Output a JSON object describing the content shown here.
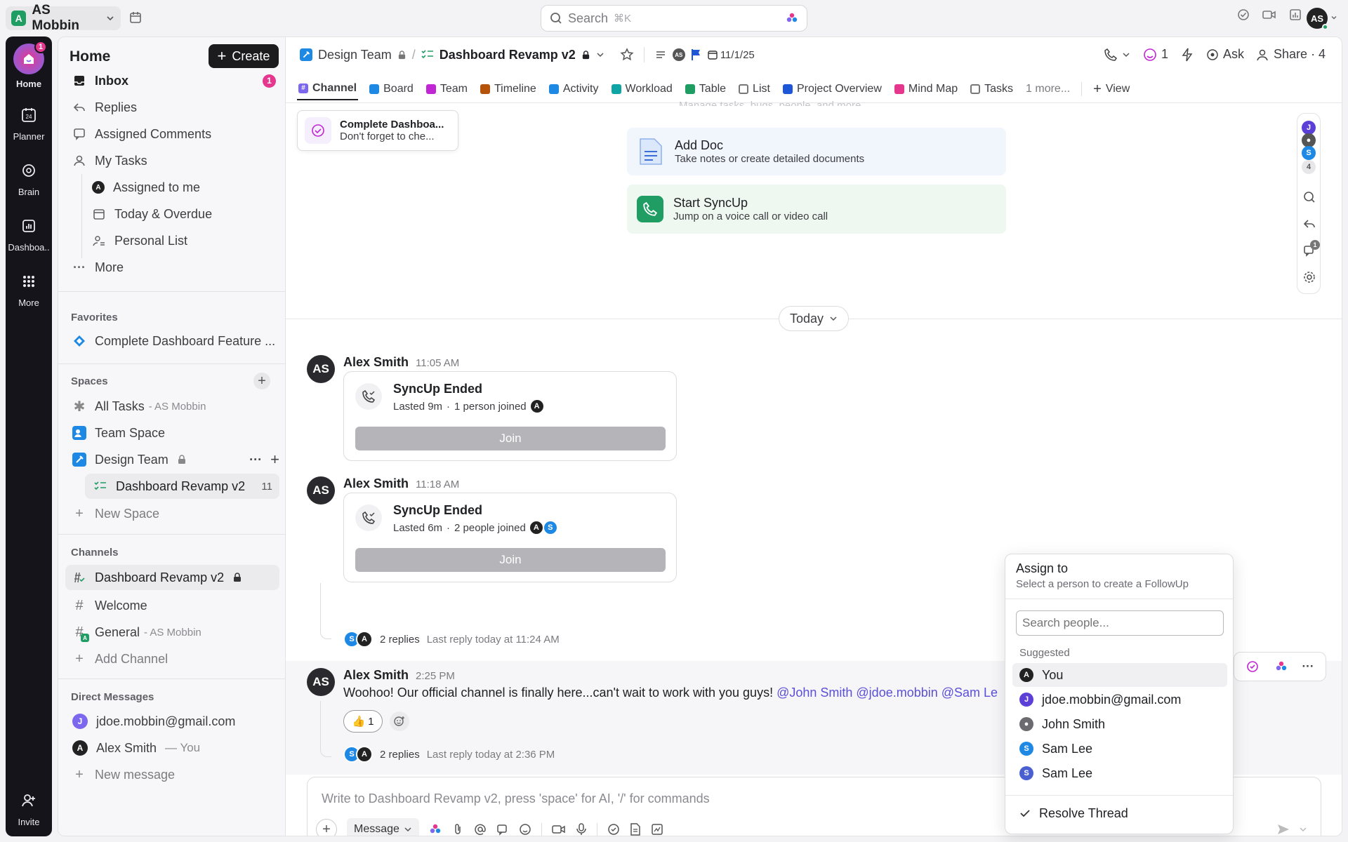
{
  "workspace": {
    "name": "AS Mobbin",
    "badge": "A"
  },
  "search": {
    "label": "Search",
    "shortcut": "⌘K"
  },
  "user": {
    "initials": "AS"
  },
  "rail": {
    "home": {
      "label": "Home",
      "badge": "1"
    },
    "planner": {
      "label": "Planner",
      "day": "24"
    },
    "brain": {
      "label": "Brain"
    },
    "dashboards": {
      "label": "Dashboa.."
    },
    "more": {
      "label": "More"
    },
    "invite": {
      "label": "Invite"
    }
  },
  "sidebar": {
    "title": "Home",
    "create_label": "Create",
    "inbox": {
      "label": "Inbox",
      "count": "1"
    },
    "replies": "Replies",
    "assigned_comments": "Assigned Comments",
    "my_tasks": "My Tasks",
    "assigned_to_me": "Assigned to me",
    "today_overdue": "Today & Overdue",
    "personal_list": "Personal List",
    "more": "More",
    "favorites_header": "Favorites",
    "favorite_item": "Complete Dashboard Feature ...",
    "spaces_header": "Spaces",
    "all_tasks": "All Tasks",
    "all_tasks_sub": "- AS Mobbin",
    "team_space": "Team Space",
    "design_team": "Design Team",
    "dashboard_revamp": "Dashboard Revamp v2",
    "dashboard_revamp_count": "11",
    "new_space": "New Space",
    "channels_header": "Channels",
    "channel_dashboard": "Dashboard Revamp v2",
    "channel_welcome": "Welcome",
    "channel_general": "General",
    "channel_general_sub": "- AS Mobbin",
    "add_channel": "Add Channel",
    "dm_header": "Direct Messages",
    "dm_jdoe": "jdoe.mobbin@gmail.com",
    "dm_alex": "Alex Smith",
    "dm_alex_sub": "— You",
    "new_message": "New message"
  },
  "header": {
    "crumb_space": "Design Team",
    "crumb_list": "Dashboard Revamp v2",
    "date": "11/1/25",
    "followers": "1",
    "ask": "Ask",
    "share": "Share · 4"
  },
  "tabs": [
    "Channel",
    "Board",
    "Team",
    "Timeline",
    "Activity",
    "Workload",
    "Table",
    "List",
    "Project Overview",
    "Mind Map",
    "Tasks"
  ],
  "tabs_more": "1 more...",
  "tabs_view": "View",
  "reminder": {
    "title": "Complete Dashboa...",
    "sub": "Don't forget to che..."
  },
  "partial_line": "Manage tasks, bugs, people, and more",
  "add_doc": {
    "title": "Add Doc",
    "sub": "Take notes or create detailed documents"
  },
  "start_syncup": {
    "title": "Start SyncUp",
    "sub": "Jump on a voice call or video call"
  },
  "right_rail": {
    "count": "4",
    "comment_badge": "1"
  },
  "divider": {
    "label": "Today"
  },
  "messages": [
    {
      "author": "Alex Smith",
      "time": "11:05 AM",
      "card_title": "SyncUp Ended",
      "card_sub": "Lasted 9m",
      "card_joined": "1 person joined",
      "join": "Join"
    },
    {
      "author": "Alex Smith",
      "time": "11:18 AM",
      "card_title": "SyncUp Ended",
      "card_sub": "Lasted 6m",
      "card_joined": "2 people joined",
      "join": "Join",
      "replies": "2 replies",
      "last_reply": "Last reply today at 11:24 AM"
    },
    {
      "author": "Alex Smith",
      "time": "2:25 PM",
      "text": "Woohoo! Our official channel is finally here...can't wait to work with you guys!",
      "mentions": "@John Smith @jdoe.mobbin @Sam Le",
      "reaction": "1",
      "replies": "2 replies",
      "last_reply": "Last reply today at 2:36 PM"
    }
  ],
  "composer": {
    "placeholder": "Write to Dashboard Revamp v2, press 'space' for AI, '/' for commands",
    "type": "Message"
  },
  "popup": {
    "title": "Assign to",
    "subtitle": "Select a person to create a FollowUp",
    "search_placeholder": "Search people...",
    "suggested": "Suggested",
    "people": [
      "You",
      "jdoe.mobbin@gmail.com",
      "John Smith",
      "Sam Lee",
      "Sam Lee"
    ],
    "resolve": "Resolve Thread"
  },
  "colors": {
    "accent": "#7b68ee",
    "brand_green": "#1f9d63",
    "blue": "#1e88e5",
    "pink": "#e6378e"
  }
}
